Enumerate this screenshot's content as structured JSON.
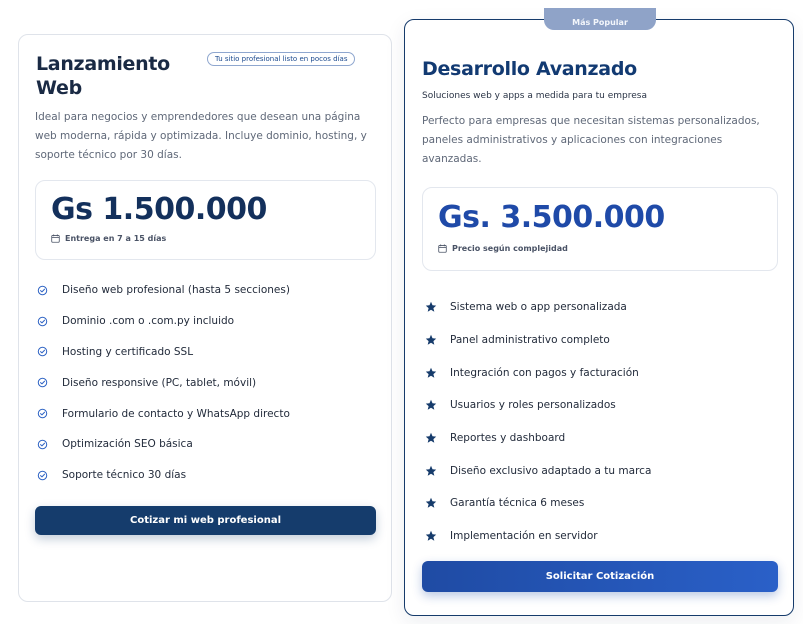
{
  "badge_popular": "Más Popular",
  "basic": {
    "title": "Lanzamiento Web",
    "tagline": "Tu sitio profesional listo en pocos días",
    "description": "Ideal para negocios y emprendedores que desean una página web moderna, rápida y optimizada. Incluye dominio, hosting, y soporte técnico por 30 días.",
    "price": "Gs 1.500.000",
    "price_note": "Entrega en 7 a 15 días",
    "features": [
      "Diseño web profesional (hasta 5 secciones)",
      "Dominio .com o .com.py incluido",
      "Hosting y certificado SSL",
      "Diseño responsive (PC, tablet, móvil)",
      "Formulario de contacto y WhatsApp directo",
      "Optimización SEO básica",
      "Soporte técnico 30 días"
    ],
    "button": "Cotizar mi web profesional"
  },
  "pro": {
    "title": "Desarrollo Avanzado",
    "subtitle": "Soluciones web y apps a medida para tu empresa",
    "description": "Perfecto para empresas que necesitan sistemas personalizados, paneles administrativos y aplicaciones con integraciones avanzadas.",
    "price": "Gs. 3.500.000",
    "price_note": "Precio según complejidad",
    "features": [
      "Sistema web o app personalizada",
      "Panel administrativo completo",
      "Integración con pagos y facturación",
      "Usuarios y roles personalizados",
      "Reportes y dashboard",
      "Diseño exclusivo adaptado a tu marca",
      "Garantía técnica 6 meses",
      "Implementación en servidor"
    ],
    "button": "Solicitar Cotización"
  },
  "icons": {
    "basic_feature": "check-circle-icon",
    "pro_feature": "star-icon",
    "price_note": "calendar-icon"
  },
  "colors": {
    "primary_dark": "#153c6c",
    "primary_blue": "#1f4aa8",
    "check": "#2e63c4"
  }
}
